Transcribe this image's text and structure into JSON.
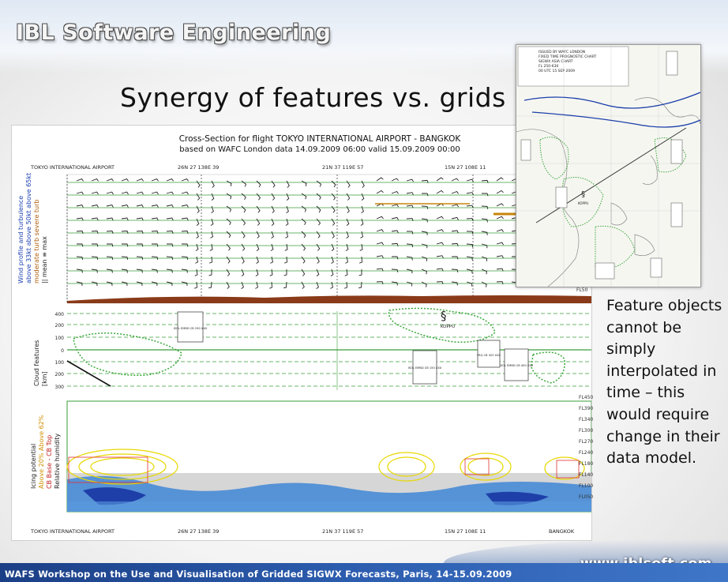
{
  "header": {
    "brand": "IBL Software Engineering",
    "title": "Synergy of features vs. grids"
  },
  "cross_section": {
    "title_line1": "Cross-Section for flight TOKYO INTERNATIONAL AIRPORT - BANGKOK",
    "title_line2": "based on WAFC London data 14.09.2009 06:00 valid 15.09.2009 00:00",
    "route_start": "TOKYO INTERNATIONAL AIRPORT",
    "route_end": "BANGKOK",
    "waypoints": [
      "26N 27 138E 39",
      "21N 37 119E 57",
      "15N 27 108E 11"
    ],
    "panel1_label_lines": [
      "Wind profile and turbulence",
      "above 33kt above 50kt above 65kt",
      "moderate turb severe turb",
      "|| mean ≡ max"
    ],
    "panel2_label_lines": [
      "Cloud features",
      "[km]"
    ],
    "panel2_yticks": [
      "400",
      "200",
      "100",
      "0",
      "100",
      "200",
      "300"
    ],
    "panel3_label_lines": [
      "Icing potential",
      "Above 20% Above 62%",
      "CB Base - CB Top",
      "Relative humidity"
    ],
    "flight_levels": [
      "FL450",
      "FL390",
      "FL340",
      "FL300",
      "FL270",
      "FL240",
      "FL180",
      "FL140",
      "FL100",
      "FL050"
    ],
    "panel1_fl_label": "FL50",
    "annotations": [
      {
        "label": "ISOL EMBD CB 290 XXX"
      },
      {
        "label": "ISOL EMBD CB 150 XXX"
      },
      {
        "label": "FRQ CB 320 XXX"
      },
      {
        "label": "ISOL EMBD CB 400 XXX"
      },
      {
        "label": "KOPPU"
      }
    ]
  },
  "map": {
    "header_lines": [
      "ISSUED BY WAFC LONDON",
      "FIXED TIME PROGNOSTIC CHART",
      "SIGWX ASIA CHART",
      "FL 250-630",
      "00 UTC 15 SEP 2009"
    ],
    "tc_label": "KOPPU"
  },
  "side_text": "Feature objects cannot be simply interpolated in time – this would require change in their data model.",
  "footer": {
    "text": "WAFS Workshop on the Use and Visualisation of Gridded SIGWX Forecasts, Paris, 14-15.09.2009",
    "url": "www.iblsoft.com"
  },
  "colors": {
    "footer_blue": "#2d5eb0",
    "cloud_green": "#3aa83a",
    "icing_yellow": "#e8d800",
    "humidity_blue": "#2a5fc0"
  }
}
